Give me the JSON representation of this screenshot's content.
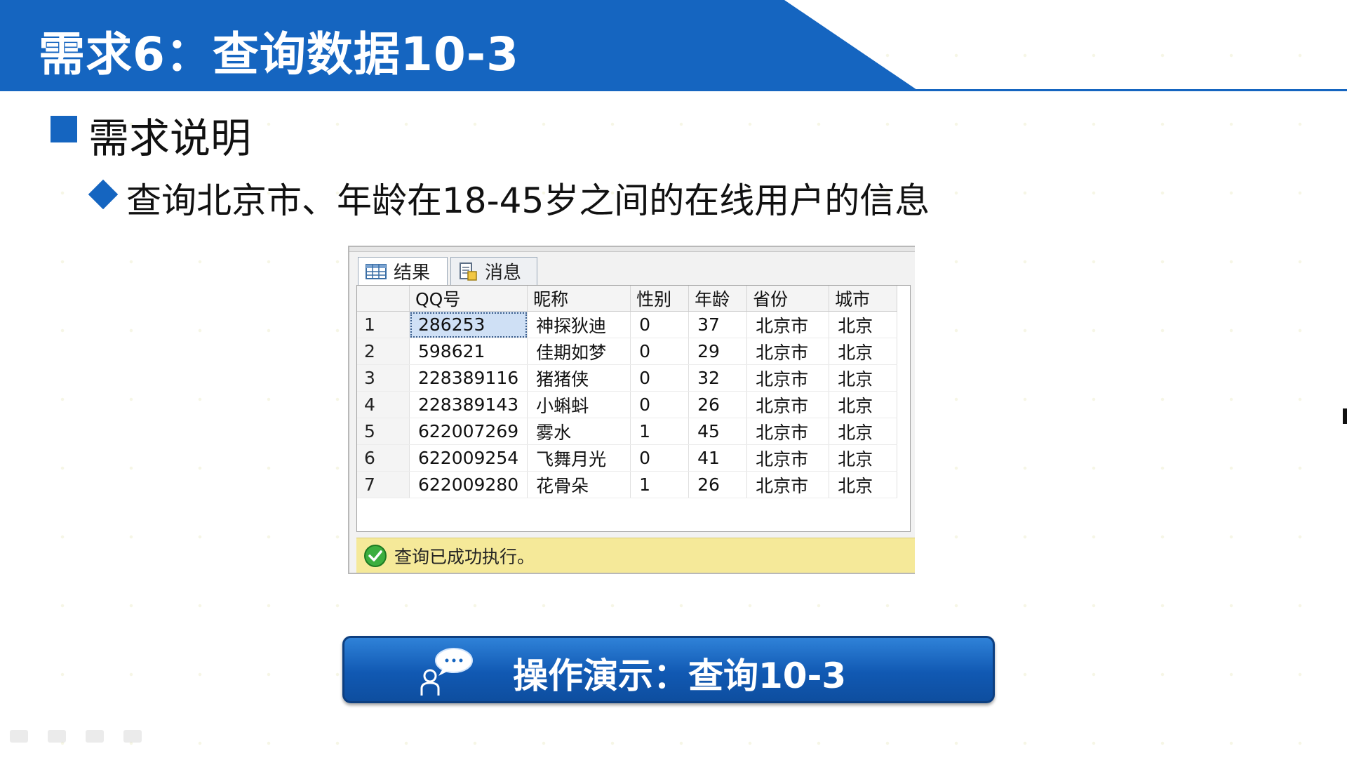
{
  "slide": {
    "title": "需求6：查询数据10-3",
    "section_heading": "需求说明",
    "requirement": "查询北京市、年龄在18-45岁之间的在线用户的信息"
  },
  "query_panel": {
    "tabs": [
      {
        "label": "结果",
        "icon": "grid-icon"
      },
      {
        "label": "消息",
        "icon": "document-icon"
      }
    ],
    "columns": [
      "QQ号",
      "昵称",
      "性别",
      "年龄",
      "省份",
      "城市"
    ],
    "rows": [
      {
        "n": "1",
        "qq": "286253",
        "nick": "神探狄迪",
        "sex": "0",
        "age": "37",
        "prov": "北京市",
        "city": "北京"
      },
      {
        "n": "2",
        "qq": "598621",
        "nick": "佳期如梦",
        "sex": "0",
        "age": "29",
        "prov": "北京市",
        "city": "北京"
      },
      {
        "n": "3",
        "qq": "228389116",
        "nick": "猪猪侠",
        "sex": "0",
        "age": "32",
        "prov": "北京市",
        "city": "北京"
      },
      {
        "n": "4",
        "qq": "228389143",
        "nick": "小蝌蚪",
        "sex": "0",
        "age": "26",
        "prov": "北京市",
        "city": "北京"
      },
      {
        "n": "5",
        "qq": "622007269",
        "nick": "雾水",
        "sex": "1",
        "age": "45",
        "prov": "北京市",
        "city": "北京"
      },
      {
        "n": "6",
        "qq": "622009254",
        "nick": "飞舞月光",
        "sex": "0",
        "age": "41",
        "prov": "北京市",
        "city": "北京"
      },
      {
        "n": "7",
        "qq": "622009280",
        "nick": "花骨朵",
        "sex": "1",
        "age": "26",
        "prov": "北京市",
        "city": "北京"
      }
    ],
    "status": "查询已成功执行。",
    "status_icon": "success-check-icon"
  },
  "demo_button": {
    "label": "操作演示：查询10-3",
    "icon": "presenter-chat-icon"
  },
  "colors": {
    "brand_blue": "#1565c0",
    "status_yellow": "#f5e999",
    "selection_blue": "#cfe0f5"
  }
}
